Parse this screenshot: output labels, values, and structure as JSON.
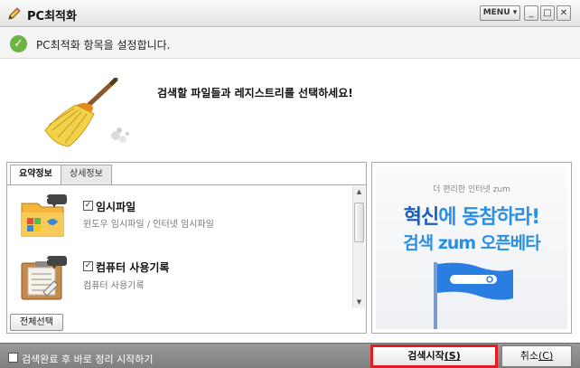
{
  "window": {
    "title": "PC최적화",
    "menu_label": "MENU",
    "menu_arrow": "▾",
    "minimize_glyph": "_",
    "maximize_glyph": "□",
    "close_glyph": "✕",
    "title_icon": "pencil-icon"
  },
  "status": {
    "icon": "check-icon",
    "check_glyph": "✓",
    "text": "PC최적화 항목을 설정합니다.",
    "icon_color": "#6db33f"
  },
  "header": {
    "icon": "broom-icon",
    "instruction": "검색할 파일들과 레지스트리를 선택하세요!"
  },
  "tabs": [
    {
      "label": "요약정보",
      "active": true
    },
    {
      "label": "상세정보",
      "active": false
    }
  ],
  "items": [
    {
      "title": "임시파일",
      "desc": "윈도우 임시파일 / 인터넷 임시파일",
      "checked": true,
      "check_glyph": "✓",
      "icon": "temp-files-icon",
      "badge": "..."
    },
    {
      "title": "컴퓨터 사용기록",
      "desc": "컴퓨터 사용기록",
      "checked": true,
      "check_glyph": "✓",
      "icon": "usage-history-icon",
      "badge": "..."
    }
  ],
  "scrollbar": {
    "up": "▲",
    "down": "▼"
  },
  "select_all_label": "전체선택",
  "ad": {
    "sub": "더 편리한 인터넷 zum",
    "line1_a": "혁신",
    "line1_b": "에 동참하라!",
    "line2": "검색 zum 오픈베타",
    "flag_icon": "flag-icon",
    "primary_color": "#1b5db8",
    "accent_color": "#2b8fe3"
  },
  "footer": {
    "auto_clean_label": "검색완료 후 바로 정리 시작하기",
    "auto_clean_checked": false,
    "start_label": "검색시작",
    "start_key": "(S)",
    "cancel_label": "취소",
    "cancel_key": "(C)",
    "highlight_color": "#e31c23"
  }
}
